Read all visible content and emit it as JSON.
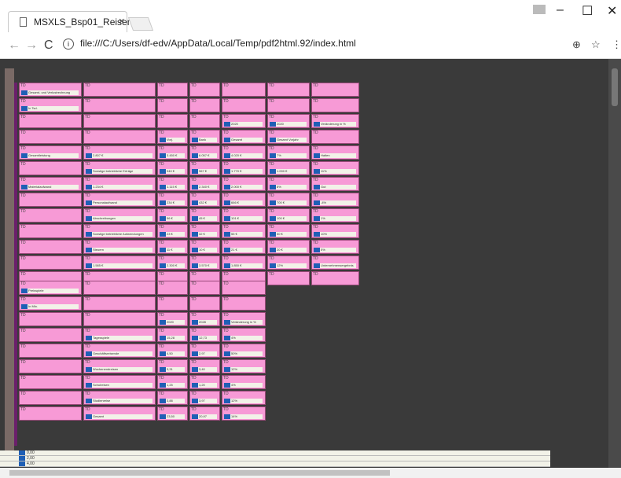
{
  "browser": {
    "tab_title": "MSXLS_Bsp01_Reisen.pd",
    "tab_close": "×",
    "url": "file:///C:/Users/df-edv/AppData/Local/Temp/pdf2html.92/index.html",
    "win_minimize": "–",
    "win_maximize": "☐",
    "win_close": "✕"
  },
  "cells": [
    {
      "t": "TD",
      "f": "Gesamt- und Verlustrechnung"
    },
    {
      "t": "TD",
      "f": ""
    },
    {
      "t": "TD",
      "f": ""
    },
    {
      "t": "TD",
      "f": ""
    },
    {
      "t": "TD",
      "f": ""
    },
    {
      "t": "TD",
      "f": ""
    },
    {
      "t": "TD",
      "f": ""
    },
    {
      "t": "TD",
      "f": "In Tsd."
    },
    {
      "t": "TD",
      "f": ""
    },
    {
      "t": "TD",
      "f": ""
    },
    {
      "t": "TD",
      "f": ""
    },
    {
      "t": "TD",
      "f": ""
    },
    {
      "t": "TD",
      "f": ""
    },
    {
      "t": "TD",
      "f": ""
    },
    {
      "t": "TD",
      "f": ""
    },
    {
      "t": "TD",
      "f": ""
    },
    {
      "t": "TD",
      "f": ""
    },
    {
      "t": "TD",
      "f": ""
    },
    {
      "t": "TD",
      "f": "2020"
    },
    {
      "t": "TD",
      "f": "2020"
    },
    {
      "t": "TD",
      "f": "Veränderung in %"
    },
    {
      "t": "TD",
      "f": ""
    },
    {
      "t": "TD",
      "f": ""
    },
    {
      "t": "TD",
      "f": "Vorj."
    },
    {
      "t": "TD",
      "f": "Bank"
    },
    {
      "t": "TD",
      "f": "Gesamt"
    },
    {
      "t": "TD",
      "f": "Gesamt Vorjahr"
    },
    {
      "t": "TD",
      "f": ""
    },
    {
      "t": "TD",
      "f": "Gesamtleistung"
    },
    {
      "t": "TD",
      "f": "2.807 €"
    },
    {
      "t": "TD",
      "f": "3.450 €"
    },
    {
      "t": "TD",
      "f": "6.057 €"
    },
    {
      "t": "TD",
      "f": "4.020 €"
    },
    {
      "t": "TD",
      "f": "7%"
    },
    {
      "t": "TD",
      "f": "Halten"
    },
    {
      "t": "TD",
      "f": ""
    },
    {
      "t": "TD",
      "f": "Sonstige betriebliche Erträge"
    },
    {
      "t": "TD",
      "f": "940 €"
    },
    {
      "t": "TD",
      "f": "967 €"
    },
    {
      "t": "TD",
      "f": "1.770 €"
    },
    {
      "t": "TD",
      "f": "1.000 €"
    },
    {
      "t": "TD",
      "f": "11%"
    },
    {
      "t": "TD",
      "f": "Materialaufwand"
    },
    {
      "t": "TD",
      "f": "1.234 €"
    },
    {
      "t": "TD",
      "f": "1.115 €"
    },
    {
      "t": "TD",
      "f": "2.340 €"
    },
    {
      "t": "TD",
      "f": "2.000 €"
    },
    {
      "t": "TD",
      "f": "8%"
    },
    {
      "t": "TD",
      "f": "Gut"
    },
    {
      "t": "TD",
      "f": ""
    },
    {
      "t": "TD",
      "f": "Personalaufwand"
    },
    {
      "t": "TD",
      "f": "234 €"
    },
    {
      "t": "TD",
      "f": "432 €"
    },
    {
      "t": "TD",
      "f": "666 €"
    },
    {
      "t": "TD",
      "f": "700 €"
    },
    {
      "t": "TD",
      "f": "-4%"
    },
    {
      "t": "TD",
      "f": ""
    },
    {
      "t": "TD",
      "f": "Abschreibungen"
    },
    {
      "t": "TD",
      "f": "56 €"
    },
    {
      "t": "TD",
      "f": "45 €"
    },
    {
      "t": "TD",
      "f": "101 €"
    },
    {
      "t": "TD",
      "f": "100 €"
    },
    {
      "t": "TD",
      "f": "1%"
    },
    {
      "t": "TD",
      "f": ""
    },
    {
      "t": "TD",
      "f": "Sonstige betriebliche Aufwendungen"
    },
    {
      "t": "TD",
      "f": "23 €"
    },
    {
      "t": "TD",
      "f": "32 €"
    },
    {
      "t": "TD",
      "f": "55 €"
    },
    {
      "t": "TD",
      "f": "50 €"
    },
    {
      "t": "TD",
      "f": "10%"
    },
    {
      "t": "TD",
      "f": ""
    },
    {
      "t": "TD",
      "f": "Steuern"
    },
    {
      "t": "TD",
      "f": "11 €"
    },
    {
      "t": "TD",
      "f": "10 €"
    },
    {
      "t": "TD",
      "f": "21 €"
    },
    {
      "t": "TD",
      "f": "20 €"
    },
    {
      "t": "TD",
      "f": "5%"
    },
    {
      "t": "TD",
      "f": ""
    },
    {
      "t": "TD",
      "f": "1.585 €"
    },
    {
      "t": "TD",
      "f": "2.300 €"
    },
    {
      "t": "TD",
      "f": "3.570 €"
    },
    {
      "t": "TD",
      "f": "1.850 €"
    },
    {
      "t": "TD",
      "f": "12%"
    },
    {
      "t": "TD",
      "f": "Unternehmensergebnis"
    },
    {
      "t": "TD",
      "f": ""
    },
    {
      "t": "TD",
      "f": ""
    },
    {
      "t": "TD",
      "f": ""
    },
    {
      "t": "TD",
      "f": ""
    },
    {
      "t": "TD",
      "f": ""
    },
    {
      "t": "TD",
      "f": ""
    },
    {
      "t": "TD",
      "f": ""
    }
  ],
  "cells2": [
    {
      "t": "TD",
      "f": "Preisspiele"
    },
    {
      "t": "TD",
      "f": ""
    },
    {
      "t": "TD",
      "f": ""
    },
    {
      "t": "TD",
      "f": ""
    },
    {
      "t": "TD",
      "f": ""
    },
    {
      "t": "TD",
      "f": "In Mio."
    },
    {
      "t": "TD",
      "f": ""
    },
    {
      "t": "TD",
      "f": ""
    },
    {
      "t": "TD",
      "f": ""
    },
    {
      "t": "TD",
      "f": ""
    },
    {
      "t": "TD",
      "f": ""
    },
    {
      "t": "TD",
      "f": ""
    },
    {
      "t": "TD",
      "f": "2020"
    },
    {
      "t": "TD",
      "f": "2028"
    },
    {
      "t": "TD",
      "f": "Veränderung in %"
    },
    {
      "t": "TD",
      "f": ""
    },
    {
      "t": "TD",
      "f": "Tagesspiele"
    },
    {
      "t": "TD",
      "f": "15,28"
    },
    {
      "t": "TD",
      "f": "12,73"
    },
    {
      "t": "TD",
      "f": "4%"
    },
    {
      "t": "TD",
      "f": ""
    },
    {
      "t": "TD",
      "f": "Geschäftsreisende"
    },
    {
      "t": "TD",
      "f": "4,50"
    },
    {
      "t": "TD",
      "f": "2,97"
    },
    {
      "t": "TD",
      "f": "50%"
    },
    {
      "t": "TD",
      "f": ""
    },
    {
      "t": "TD",
      "f": "Wochenendreisen"
    },
    {
      "t": "TD",
      "f": "3,31"
    },
    {
      "t": "TD",
      "f": "3,40"
    },
    {
      "t": "TD",
      "f": "12%"
    },
    {
      "t": "TD",
      "f": ""
    },
    {
      "t": "TD",
      "f": "Schulreisen"
    },
    {
      "t": "TD",
      "f": "1,25"
    },
    {
      "t": "TD",
      "f": "1,20"
    },
    {
      "t": "TD",
      "f": "4%"
    },
    {
      "t": "TD",
      "f": ""
    },
    {
      "t": "TD",
      "f": "Studienreise"
    },
    {
      "t": "TD",
      "f": "3,88"
    },
    {
      "t": "TD",
      "f": "3,97"
    },
    {
      "t": "TD",
      "f": "12%"
    },
    {
      "t": "TD",
      "f": ""
    },
    {
      "t": "TD",
      "f": "Gesamt"
    },
    {
      "t": "TD",
      "f": "23,50"
    },
    {
      "t": "TD",
      "f": "20,97"
    },
    {
      "t": "TD",
      "f": "14%"
    }
  ],
  "footer_rows": [
    "0,00",
    "2,00",
    "4,00"
  ]
}
